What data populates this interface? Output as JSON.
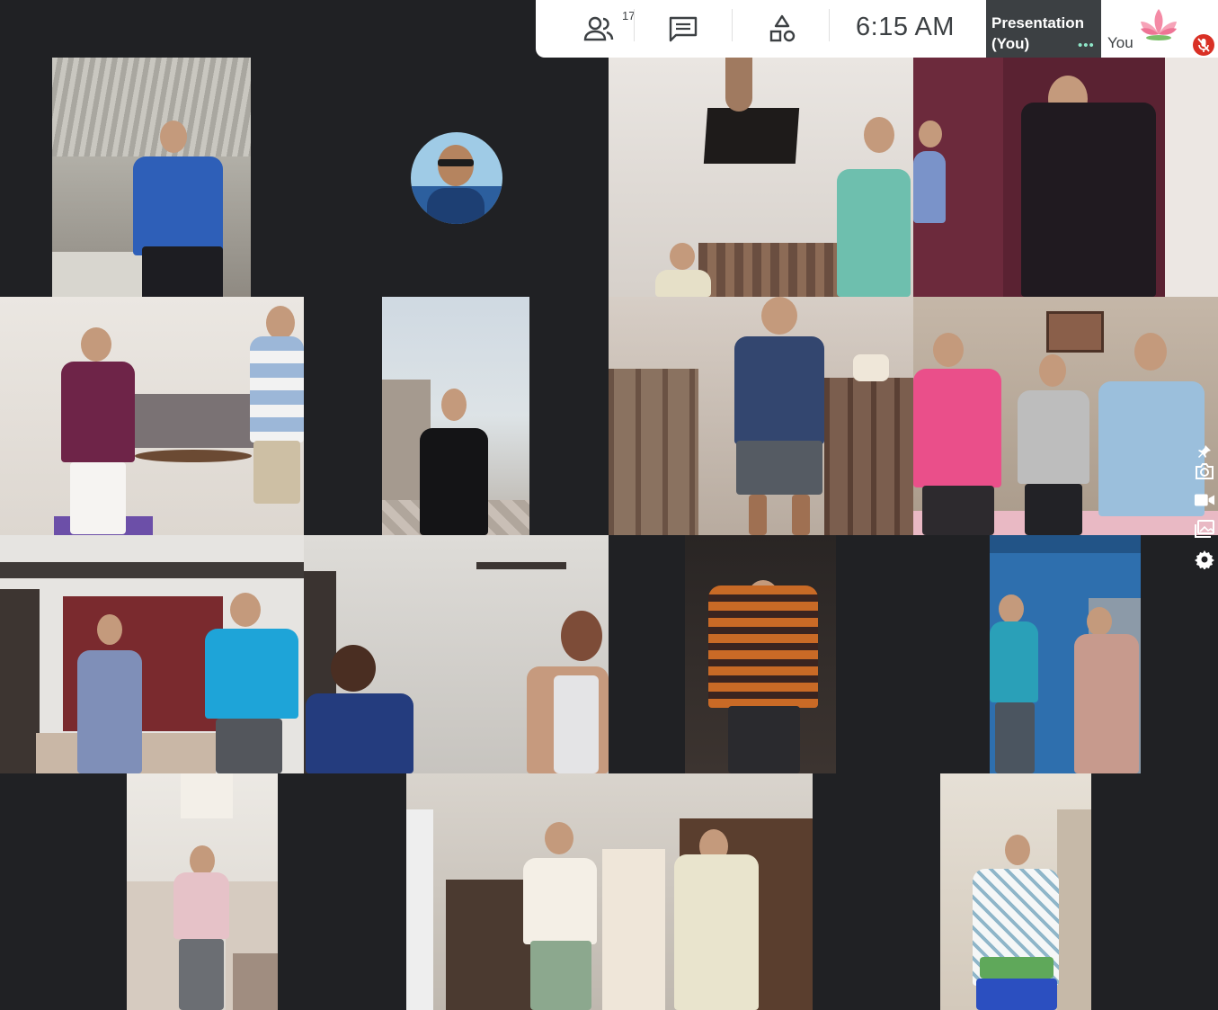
{
  "toolbar": {
    "participants_count": "17",
    "time": "6:15  AM",
    "presentation_label": "Presentation (You)",
    "presentation_dots": "•••",
    "self_label": "You"
  },
  "icons": {
    "people": "people-icon",
    "chat": "chat-icon",
    "activities": "activities-icon",
    "lotus": "lotus-icon",
    "mic_off": "mic-off-icon",
    "pin": "pin-icon",
    "camera": "camera-icon",
    "video": "video-icon",
    "gallery": "gallery-icon",
    "settings": "settings-icon"
  },
  "colors": {
    "meeting_background": "#202124",
    "toolbar_background": "#ffffff",
    "presentation_tile": "#3c4043",
    "mic_off_red": "#d93025",
    "active_dots": "#8ee6c8"
  }
}
